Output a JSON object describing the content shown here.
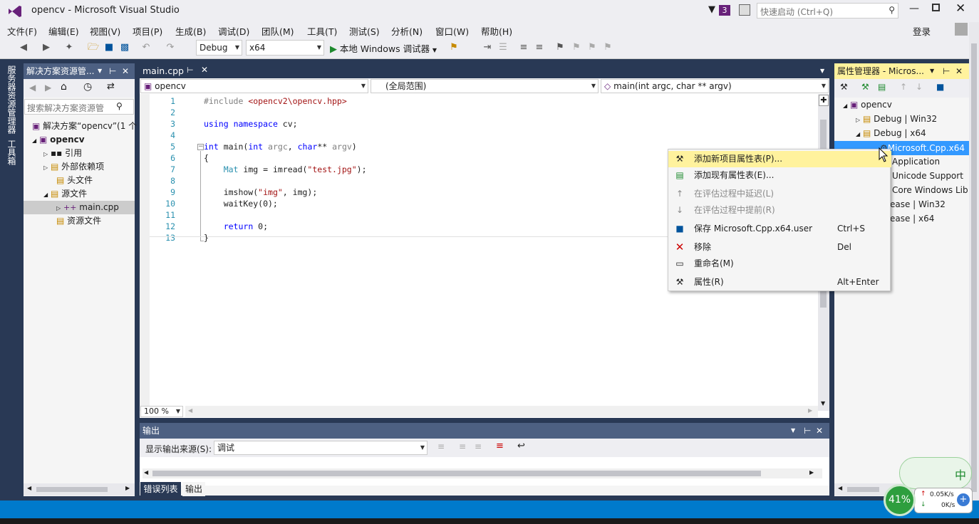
{
  "window": {
    "title": "opencv - Microsoft Visual Studio",
    "notification_count": "3",
    "quick_launch_placeholder": "快速启动 (Ctrl+Q)",
    "signin": "登录"
  },
  "menu": [
    "文件(F)",
    "编辑(E)",
    "视图(V)",
    "项目(P)",
    "生成(B)",
    "调试(D)",
    "团队(M)",
    "工具(T)",
    "测试(S)",
    "分析(N)",
    "窗口(W)",
    "帮助(H)"
  ],
  "toolbar": {
    "config": "Debug",
    "platform": "x64",
    "run_label": "本地 Windows 调试器"
  },
  "left_vertical_tabs": [
    "服务器资源管理器",
    "工具箱"
  ],
  "solution_explorer": {
    "title": "解决方案资源管... ",
    "search_placeholder": "搜索解决方案资源管",
    "tree": [
      {
        "label": "解决方案“opencv”(1 个",
        "bold": false
      },
      {
        "label": "opencv",
        "bold": true
      },
      {
        "label": "引用",
        "bold": false
      },
      {
        "label": "外部依赖项",
        "bold": false
      },
      {
        "label": "头文件",
        "bold": false
      },
      {
        "label": "源文件",
        "bold": false
      },
      {
        "label": "main.cpp",
        "bold": false
      },
      {
        "label": "资源文件",
        "bold": false
      }
    ]
  },
  "editor": {
    "tab": "main.cpp",
    "nav_project": "opencv",
    "nav_scope": "(全局范围)",
    "nav_member": "main(int argc, char ** argv)",
    "zoom": "100 %",
    "line_numbers": [
      "1",
      "2",
      "3",
      "4",
      "5",
      "6",
      "7",
      "8",
      "9",
      "10",
      "11",
      "12",
      "13"
    ]
  },
  "output": {
    "title": "输出",
    "source_label": "显示输出来源(S):",
    "source_value": "调试",
    "tabs": [
      "错误列表",
      "输出"
    ]
  },
  "property_manager": {
    "title": "属性管理器 - Micros...",
    "tree": [
      {
        "label": "opencv"
      },
      {
        "label": "Debug | Win32"
      },
      {
        "label": "Debug | x64"
      },
      {
        "label": "Microsoft.Cpp.x64"
      },
      {
        "label": "Application"
      },
      {
        "label": "Unicode Support"
      },
      {
        "label": "Core Windows Lib"
      },
      {
        "label": "ease | Win32"
      },
      {
        "label": "ease | x64"
      }
    ]
  },
  "context_menu": [
    {
      "label": "添加新项目属性表(P)...",
      "shortcut": "",
      "icon": "wrench-add-icon",
      "disabled": false,
      "highlight": true
    },
    {
      "label": "添加现有属性表(E)...",
      "shortcut": "",
      "icon": "add-existing-icon",
      "disabled": false,
      "highlight": false
    },
    {
      "label": "在评估过程中延迟(L)",
      "shortcut": "",
      "icon": "arrow-up-icon",
      "disabled": true,
      "highlight": false
    },
    {
      "label": "在评估过程中提前(R)",
      "shortcut": "",
      "icon": "arrow-down-icon",
      "disabled": true,
      "highlight": false
    },
    {
      "label": "保存 Microsoft.Cpp.x64.user",
      "shortcut": "Ctrl+S",
      "icon": "save-icon",
      "disabled": false,
      "highlight": false
    },
    {
      "label": "移除",
      "shortcut": "Del",
      "icon": "remove-icon",
      "disabled": false,
      "highlight": false
    },
    {
      "label": "重命名(M)",
      "shortcut": "",
      "icon": "rename-icon",
      "disabled": false,
      "highlight": false
    },
    {
      "label": "属性(R)",
      "shortcut": "Alt+Enter",
      "icon": "properties-icon",
      "disabled": false,
      "highlight": false
    }
  ],
  "net_widget": {
    "percent": "41%",
    "up": "0.05K/s",
    "down": "0K/s",
    "ime": "中"
  },
  "colors": {
    "accent": "#007acc",
    "menu_highlight": "#fff29d",
    "tree_selection": "#3399ff"
  }
}
